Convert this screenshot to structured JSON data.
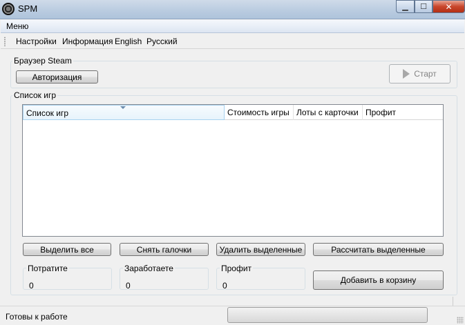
{
  "window": {
    "title": "SPM",
    "controls": {
      "minimize": "▁",
      "maximize": "☐",
      "close": "✕"
    }
  },
  "menu": {
    "items": [
      "Меню"
    ]
  },
  "toolbar": {
    "items": [
      "Настройки",
      "Информация",
      "English",
      "Русский"
    ]
  },
  "browser_group": {
    "label": "Браузер Steam",
    "auth_button": "Авторизация",
    "start_button": "Старт",
    "start_enabled": false
  },
  "games_group": {
    "label": "Список игр",
    "columns": [
      "Список игр",
      "Стоимость игры",
      "Лоты с карточки",
      "Профит"
    ],
    "rows": []
  },
  "actions": {
    "select_all": "Выделить все",
    "uncheck": "Снять галочки",
    "delete_selected": "Удалить выделенные",
    "calculate_selected": "Рассчитать выделенные",
    "add_to_cart": "Добавить в корзину"
  },
  "summary": {
    "spend": {
      "label": "Потратите",
      "value": "0"
    },
    "earn": {
      "label": "Заработаете",
      "value": "0"
    },
    "profit": {
      "label": "Профит",
      "value": "0"
    }
  },
  "status": {
    "text": "Готовы к работе",
    "progress": 0
  },
  "icons": {
    "app": "app-icon",
    "start": "play-icon"
  },
  "colors": {
    "titlebar": "#b9cbe0",
    "window_bg": "#f0f0f0",
    "close_button": "#c9462c",
    "header_sorted": "#e7f3fb"
  }
}
